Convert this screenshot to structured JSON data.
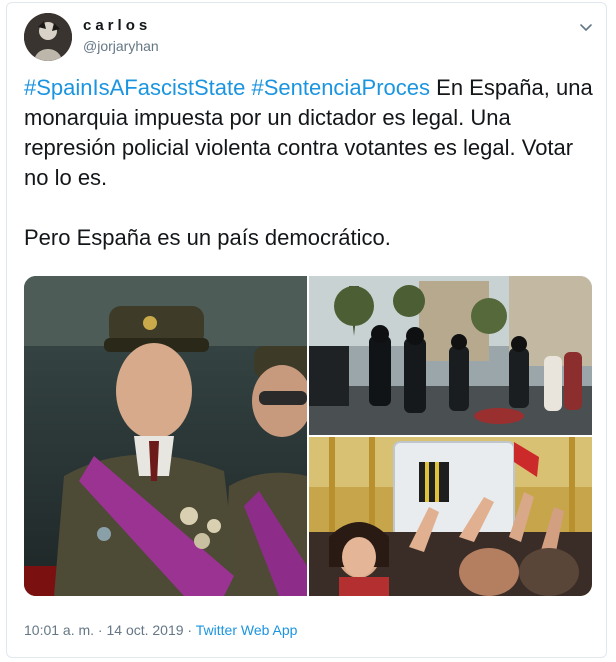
{
  "author": {
    "name": "carlos",
    "handle": "@jorjaryhan"
  },
  "tweet": {
    "hashtag_1": "#SpainIsAFascistState",
    "hashtag_2": "#SentenciaProces",
    "body_line": " En España, una monarquia impuesta por un dictador es legal. Una represión policial violenta contra votantes es legal. Votar no lo es.\n\nPero España es un país democrático."
  },
  "meta": {
    "timestamp": "10:01 a. m. · 14 oct. 2019",
    "separator": " · ",
    "source": "Twitter Web App"
  },
  "icons": {
    "caret": "chevron-down-icon"
  },
  "colors": {
    "link": "#1b95e0",
    "secondary_text": "#657786",
    "border": "#e1e8ed"
  }
}
